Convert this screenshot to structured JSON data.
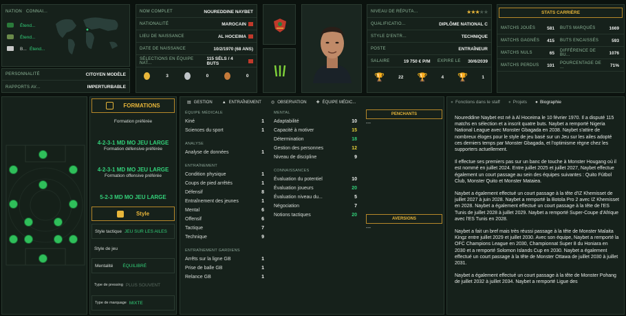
{
  "nation": {
    "header1": "NATION",
    "header2": "CONNAI...",
    "rows": [
      {
        "t": "Étend..."
      },
      {
        "t": "Étend..."
      },
      {
        "t": "Étend..."
      }
    ],
    "abbr3": "B..."
  },
  "personality": {
    "label": "PERSONNALITÉ",
    "value": "CITOYEN MODÈLE"
  },
  "reports": {
    "label": "RAPPORTS AV...",
    "value": "IMPERTURBABLE"
  },
  "info": [
    {
      "l": "NOM COMPLET",
      "v": "NOUREDDINE NAYBET"
    },
    {
      "l": "NATIONALITÉ",
      "v": "MAROCAIN"
    },
    {
      "l": "LIEU DE NAISSANCE",
      "v": "AL HOCEIMA"
    },
    {
      "l": "DATE DE NAISSANCE",
      "v": "10/2/1970 (68 ANS)"
    },
    {
      "l": "SÉLECTIONS EN ÉQUIPE NAT...",
      "v": "115 SÉLS / 4 BUTS"
    }
  ],
  "medals": [
    "3",
    "0",
    "0"
  ],
  "job": [
    {
      "l": "NIVEAU DE RÉPUTA...",
      "v": ""
    },
    {
      "l": "QUALIFICATIO...",
      "v": "DIPLÔME NATIONAL C"
    },
    {
      "l": "STYLE D'ENTR...",
      "v": "TECHNIQUE"
    },
    {
      "l": "POSTE",
      "v": "ENTRAÎNEUR"
    }
  ],
  "salary": {
    "label": "SALAIRE",
    "value": "19 750 € P/M",
    "expire_label": "EXPIRE LE",
    "expire": "30/6/2039"
  },
  "trophies": [
    "22",
    "4",
    "1"
  ],
  "stars": 3,
  "career": {
    "title": "STATS CARRIÈRE",
    "rows": [
      {
        "a": "MATCHS JOUÉS",
        "b": "581",
        "c": "BUTS MARQUÉS",
        "d": "1669"
      },
      {
        "a": "MATCHS GAGNÉS",
        "b": "415",
        "c": "BUTS ENCAISSÉS",
        "d": "593"
      },
      {
        "a": "MATCHS NULS",
        "b": "65",
        "c": "DIFFÉRENCE DE BU...",
        "d": "1076"
      },
      {
        "a": "MATCHS PERDUS",
        "b": "101",
        "c": "POURCENTAGE DE ...",
        "d": "71%"
      }
    ]
  },
  "formations": {
    "title": "FORMATIONS",
    "pref_label": "Formation préférée",
    "f1": "4-2-3-1 MD MO JEU LARGE",
    "f1sub": "Formation défensive préférée",
    "f2": "4-2-3-1 MD MO JEU LARGE",
    "f2sub": "Formation offensive préférée",
    "f3": "5-2-3 MD MO JEU LARGE"
  },
  "style": {
    "title": "Style",
    "rows": [
      {
        "l": "Style tactique",
        "v": "JEU SUR LES AILES"
      },
      {
        "l": "Style de jeu",
        "v": ""
      },
      {
        "l": "Mentalité",
        "v": "ÉQUILIBRÉ"
      },
      {
        "l": "Type de pressing",
        "v": "PLUS SOUVENT"
      },
      {
        "l": "Type de marquage",
        "v": "MIXTE"
      }
    ]
  },
  "tabs": [
    "GESTION",
    "ENTRAÎNEMENT",
    "OBSERVATION",
    "ÉQUIPE MÉDIC..."
  ],
  "col1": [
    {
      "sec": "ÉQUIPE MÉDICALE",
      "items": [
        {
          "n": "Kiné",
          "v": "1"
        },
        {
          "n": "Sciences du sport",
          "v": "1"
        }
      ]
    },
    {
      "sec": "ANALYSE",
      "items": [
        {
          "n": "Analyse de données",
          "v": "1"
        }
      ]
    },
    {
      "sec": "ENTRAÎNEMENT",
      "items": [
        {
          "n": "Condition physique",
          "v": "1"
        },
        {
          "n": "Coups de pied arrêtés",
          "v": "1"
        },
        {
          "n": "Défensif",
          "v": "8"
        },
        {
          "n": "Entraînement des jeunes",
          "v": "1"
        },
        {
          "n": "Mental",
          "v": "6"
        },
        {
          "n": "Offensif",
          "v": "6"
        },
        {
          "n": "Tactique",
          "v": "7"
        },
        {
          "n": "Technique",
          "v": "9"
        }
      ]
    },
    {
      "sec": "ENTRAÎNEMENT GARDIENS",
      "items": [
        {
          "n": "Arrêts sur la ligne GB",
          "v": "1"
        },
        {
          "n": "Prise de balle GB",
          "v": "1"
        },
        {
          "n": "Relance GB",
          "v": "1"
        }
      ]
    }
  ],
  "col2": [
    {
      "sec": "MENTAL",
      "items": [
        {
          "n": "Adaptabilité",
          "v": "10",
          "c": ""
        },
        {
          "n": "Capacité à motiver",
          "v": "15",
          "c": "yellow"
        },
        {
          "n": "Détermination",
          "v": "18",
          "c": "green"
        },
        {
          "n": "Gestion des personnes",
          "v": "12",
          "c": "yellow"
        },
        {
          "n": "Niveau de discipline",
          "v": "9",
          "c": ""
        }
      ]
    },
    {
      "sec": "CONNAISSANCES",
      "items": [
        {
          "n": "Évaluation du potentiel",
          "v": "10",
          "c": ""
        },
        {
          "n": "Évaluation joueurs",
          "v": "20",
          "c": "green"
        },
        {
          "n": "Évaluation niveau du...",
          "v": "5",
          "c": ""
        },
        {
          "n": "Négociation",
          "v": "7",
          "c": ""
        },
        {
          "n": "Notions tactiques",
          "v": "20",
          "c": "green"
        }
      ]
    }
  ],
  "penchants": {
    "title": "PENCHANTS",
    "value": "---"
  },
  "aversions": {
    "title": "AVERSIONS",
    "value": "---"
  },
  "bio": {
    "tabs": [
      "Fonctions dans le staff",
      "Projets",
      "Biographie"
    ],
    "paras": [
      "Noureddine Naybet est né à Al Hoceima le 10 février 1970. Il a disputé 115 matchs en sélection et a inscrit quatre buts. Naybet a remporté Nigeria National League avec Monster Gbagada en 2038. Naybet s'attire de nombreux éloges pour le style de jeu basé sur un Jeu sur les ailes adopté ces derniers temps par Monster Gbagada, et l'optimisme règne chez les supporters actuellement.",
      "Il effectue ses premiers pas sur un banc de touche à Monster Hougang où il est nommé en juillet 2024. Entre juillet 2025 et juillet 2027, Naybet effectue également un court passage au sein des équipes suivantes : Quito Fútbol Club, Monster Quito et Monster Mataiea.",
      "Naybet a également effectué un court passage à la tête d'IZ Khemisset de juillet 2027 à juin 2028. Naybet a remporté la Botola Pro 2 avec IZ Khemisset en 2028. Naybet a également effectué un court passage à la tête de l'ES Tunis de juillet 2028 à juillet 2029. Naybet a remporté Super-Coupe d'Afrique avec l'ES Tunis en 2028.",
      "Naybet a fait un bref mais très réussi passage à la tête de Monster Malaita Kingz entre juillet 2029 et juillet 2030. Avec son équipe, Naybet a remporté la OFC Champions League en 2030, Championnat Super 8 du Honiara en 2030 et a remporté Solomon Islands Cup en 2030. Naybet a également effectué un court passage à la tête de Monster Ottawa de juillet 2030 à juillet 2031.",
      "Naybet a également effectué un court passage à la tête de Monster Pohang de juillet 2032 à juillet 2034. Naybet a remporté Ligue des"
    ]
  }
}
